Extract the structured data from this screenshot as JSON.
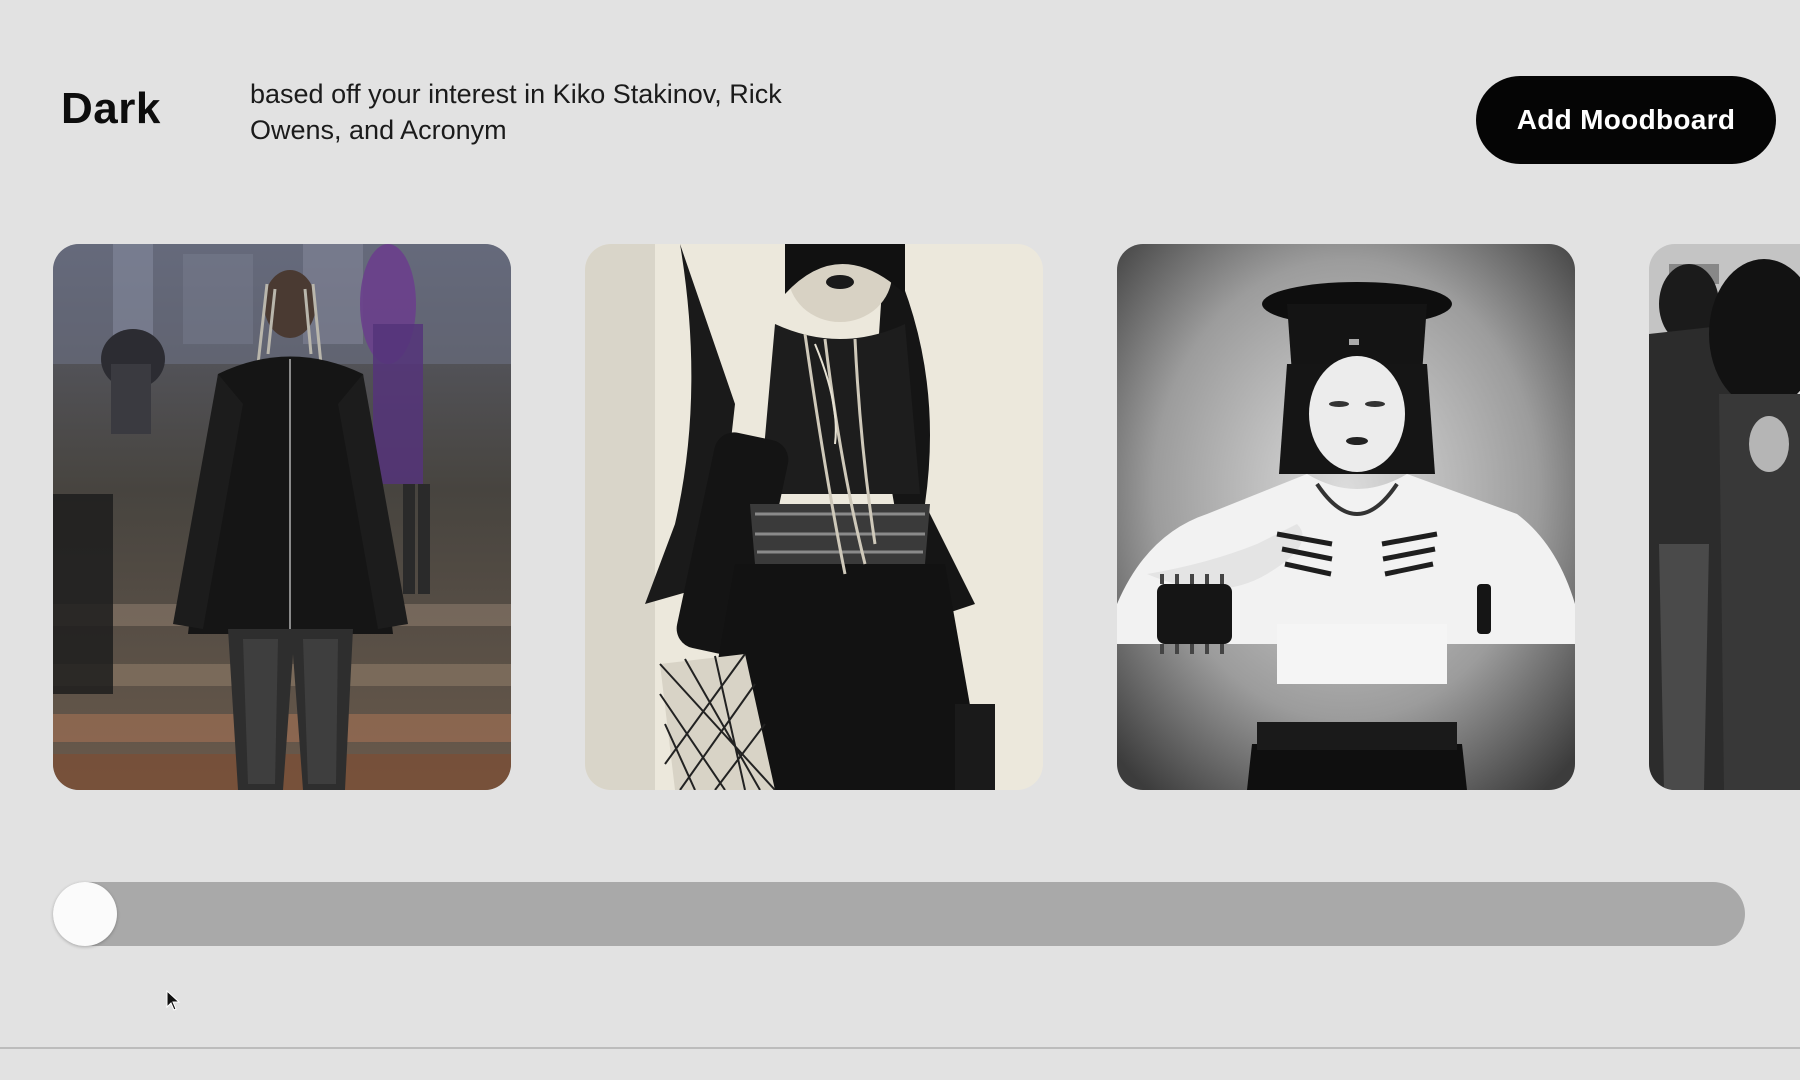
{
  "header": {
    "title": "Dark",
    "subtitle": "based off your interest in Kiko Stakinov, Rick Owens, and Acronym",
    "add_button_label": "Add Moodboard"
  },
  "moodboard": {
    "images": [
      {
        "id": "runway-look",
        "depicts": "runway model in black furry jacket and leather pants"
      },
      {
        "id": "goth-collage",
        "depicts": "gothic outfit with layered chains, corset belt and fishnets"
      },
      {
        "id": "military-cap-portrait",
        "depicts": "black and white portrait with peaked cap and spiked cuff"
      },
      {
        "id": "partial-group-photo",
        "depicts": "partially visible group in dark clothing"
      }
    ]
  },
  "slider": {
    "position_fraction": 0.0
  },
  "colors": {
    "background": "#e2e2e2",
    "button_bg": "#050505",
    "button_text": "#ffffff",
    "track": "#a9a9a9",
    "thumb": "#fbfbfb"
  }
}
